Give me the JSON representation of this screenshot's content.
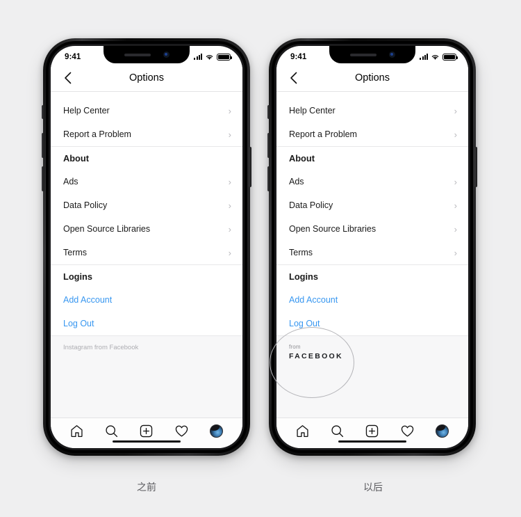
{
  "background_color": "#efeff0",
  "accent_link_color": "#3897f0",
  "phones": [
    {
      "id": "before",
      "caption": "之前",
      "status_bar": {
        "time": "9:41",
        "signal_icon": "cellular-signal-icon",
        "wifi_icon": "wifi-icon",
        "battery_icon": "battery-icon"
      },
      "nav": {
        "back_icon": "chevron-left-icon",
        "title": "Options"
      },
      "rows": [
        {
          "label": "Help Center",
          "type": "nav",
          "chevron": "›"
        },
        {
          "label": "Report a Problem",
          "type": "nav",
          "chevron": "›"
        },
        {
          "label": "About",
          "type": "header",
          "chevron": ""
        },
        {
          "label": "Ads",
          "type": "nav",
          "chevron": "›"
        },
        {
          "label": "Data Policy",
          "type": "nav",
          "chevron": "›"
        },
        {
          "label": "Open Source Libraries",
          "type": "nav",
          "chevron": "›"
        },
        {
          "label": "Terms",
          "type": "nav",
          "chevron": "›"
        },
        {
          "label": "Logins",
          "type": "header",
          "chevron": ""
        },
        {
          "label": "Add Account",
          "type": "link",
          "chevron": ""
        },
        {
          "label": "Log Out",
          "type": "link",
          "chevron": ""
        }
      ],
      "footer": {
        "style": "plain",
        "plain_text": "Instagram from Facebook"
      },
      "tabs": [
        {
          "icon": "home-icon"
        },
        {
          "icon": "search-icon"
        },
        {
          "icon": "add-post-icon"
        },
        {
          "icon": "heart-icon"
        },
        {
          "icon": "profile-avatar-icon"
        }
      ]
    },
    {
      "id": "after",
      "caption": "以后",
      "status_bar": {
        "time": "9:41",
        "signal_icon": "cellular-signal-icon",
        "wifi_icon": "wifi-icon",
        "battery_icon": "battery-icon"
      },
      "nav": {
        "back_icon": "chevron-left-icon",
        "title": "Options"
      },
      "rows": [
        {
          "label": "Help Center",
          "type": "nav",
          "chevron": "›"
        },
        {
          "label": "Report a Problem",
          "type": "nav",
          "chevron": "›"
        },
        {
          "label": "About",
          "type": "header",
          "chevron": ""
        },
        {
          "label": "Ads",
          "type": "nav",
          "chevron": "›"
        },
        {
          "label": "Data Policy",
          "type": "nav",
          "chevron": "›"
        },
        {
          "label": "Open Source Libraries",
          "type": "nav",
          "chevron": "›"
        },
        {
          "label": "Terms",
          "type": "nav",
          "chevron": "›"
        },
        {
          "label": "Logins",
          "type": "header",
          "chevron": ""
        },
        {
          "label": "Add Account",
          "type": "link",
          "chevron": ""
        },
        {
          "label": "Log Out",
          "type": "link",
          "chevron": ""
        }
      ],
      "footer": {
        "style": "branded",
        "from_text": "from",
        "brand_text": "FACEBOOK"
      },
      "tabs": [
        {
          "icon": "home-icon"
        },
        {
          "icon": "search-icon"
        },
        {
          "icon": "add-post-icon"
        },
        {
          "icon": "heart-icon"
        },
        {
          "icon": "profile-avatar-icon"
        }
      ]
    }
  ]
}
